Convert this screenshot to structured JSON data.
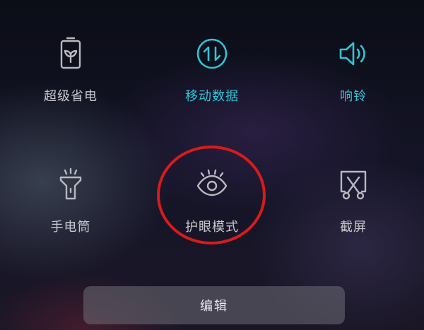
{
  "tiles": [
    {
      "id": "super-power-saving",
      "label": "超级省电",
      "icon": "battery-leaf-icon",
      "active": false
    },
    {
      "id": "mobile-data",
      "label": "移动数据",
      "icon": "data-transfer-icon",
      "active": true
    },
    {
      "id": "ringer",
      "label": "响铃",
      "icon": "speaker-icon",
      "active": true
    },
    {
      "id": "flashlight",
      "label": "手电筒",
      "icon": "flashlight-icon",
      "active": false
    },
    {
      "id": "eye-protection",
      "label": "护眼模式",
      "icon": "eye-icon",
      "active": false
    },
    {
      "id": "screenshot",
      "label": "截屏",
      "icon": "screenshot-scissors-icon",
      "active": false
    }
  ],
  "edit_button": {
    "label": "编辑"
  },
  "colors": {
    "active": "#31c4d6",
    "inactive": "#c8c8cc",
    "highlight": "#d81b1b"
  }
}
